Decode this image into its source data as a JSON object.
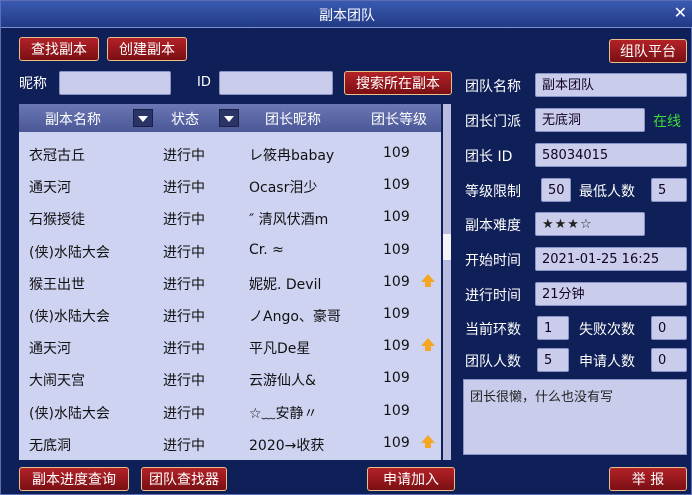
{
  "window": {
    "title": "副本团队",
    "close": "✕"
  },
  "buttons": {
    "find": "查找副本",
    "create": "创建副本",
    "platform": "组队平台",
    "search_in": "搜索所在副本",
    "progress": "副本进度查询",
    "finder": "团队查找器",
    "apply": "申请加入",
    "report": "举 报"
  },
  "search": {
    "nickname_label": "昵称",
    "id_label": "ID"
  },
  "table": {
    "headers": [
      "副本名称",
      "状态",
      "团长昵称",
      "团长等级"
    ],
    "rows": [
      {
        "name": "衣冠古丘",
        "status": "进行中",
        "leader": "レ筱冉babay",
        "level": "109",
        "up": false
      },
      {
        "name": "通天河",
        "status": "进行中",
        "leader": "Ocasr泪少",
        "level": "109",
        "up": false
      },
      {
        "name": "石猴授徒",
        "status": "进行中",
        "leader": "″ 清风伏酒m",
        "level": "109",
        "up": false
      },
      {
        "name": "(侠)水陆大会",
        "status": "进行中",
        "leader": "Cr. ≈",
        "level": "109",
        "up": false
      },
      {
        "name": "猴王出世",
        "status": "进行中",
        "leader": "妮妮. Devil",
        "level": "109",
        "up": true
      },
      {
        "name": "(侠)水陆大会",
        "status": "进行中",
        "leader": "ノAngo、豪哥",
        "level": "109",
        "up": false
      },
      {
        "name": "通天河",
        "status": "进行中",
        "leader": "平凡De星",
        "level": "109",
        "up": true
      },
      {
        "name": "大闹天宫",
        "status": "进行中",
        "leader": "云游仙人&",
        "level": "109",
        "up": false
      },
      {
        "name": "(侠)水陆大会",
        "status": "进行中",
        "leader": "☆﹏安静〃",
        "level": "109",
        "up": false
      },
      {
        "name": "无底洞",
        "status": "进行中",
        "leader": "2020→收获",
        "level": "109",
        "up": true
      }
    ]
  },
  "detail": {
    "team_name_label": "团队名称",
    "team_name": "副本团队",
    "sect_label": "团长门派",
    "sect": "无底洞",
    "online": "在线",
    "leader_id_label": "团长 ID",
    "leader_id": "58034015",
    "level_limit_label": "等级限制",
    "level_limit": "50",
    "min_people_label": "最低人数",
    "min_people": "5",
    "difficulty_label": "副本难度",
    "difficulty": "★★★☆",
    "start_label": "开始时间",
    "start": "2021-01-25 16:25",
    "duration_label": "进行时间",
    "duration": "21分钟",
    "ring_label": "当前环数",
    "ring": "1",
    "fail_label": "失败次数",
    "fail": "0",
    "members_label": "团队人数",
    "members": "5",
    "apply_label": "申请人数",
    "apply_count": "0",
    "notice": "团长很懒，什么也没有写"
  },
  "colors": {
    "bg": "#0f1f57",
    "button": "#9e1a1f",
    "online": "#3bdc3b"
  }
}
